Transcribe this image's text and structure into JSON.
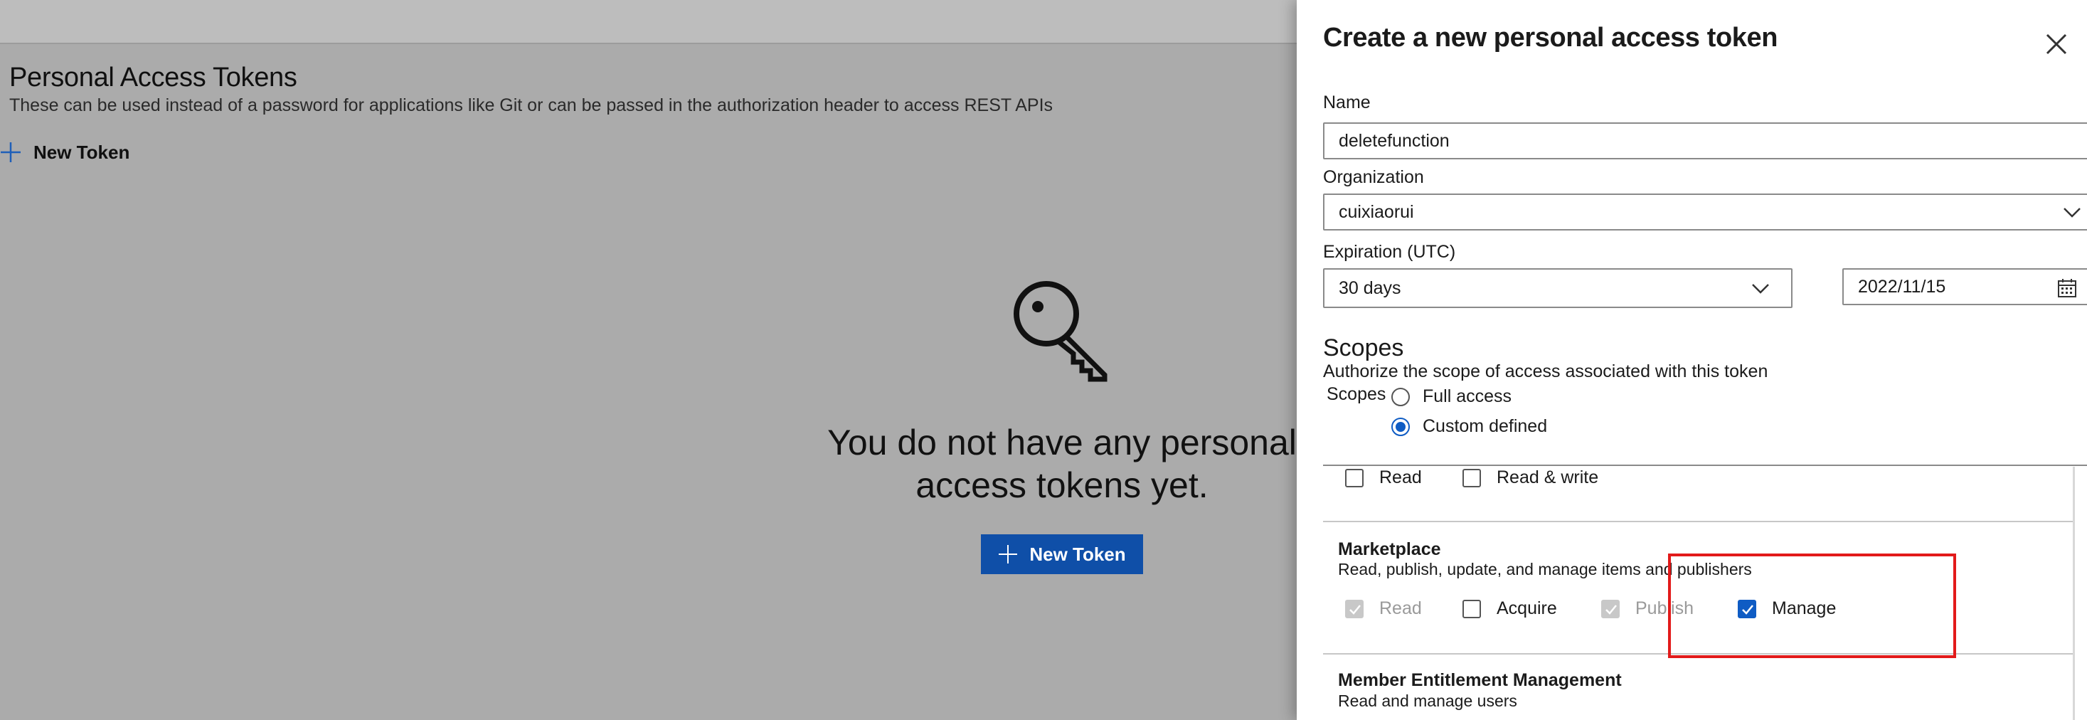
{
  "background": {
    "page_title": "Personal Access Tokens",
    "page_subtitle": "These can be used instead of a password for applications like Git or can be passed in the authorization header to access REST APIs",
    "new_token_link": "New Token",
    "empty_state_line1": "You do not have any personal",
    "empty_state_line2": "access tokens yet.",
    "new_token_button": "New Token",
    "key_icon": "key-icon"
  },
  "panel": {
    "title": "Create a new personal access token",
    "name_label": "Name",
    "name_value": "deletefunction",
    "organization_label": "Organization",
    "organization_value": "cuixiaorui",
    "expiration_label": "Expiration (UTC)",
    "expiration_value": "30 days",
    "expiration_date": "2022/11/15",
    "scopes_heading": "Scopes",
    "scopes_description": "Authorize the scope of access associated with this token",
    "scopes_inline_label": "Scopes",
    "radio_full_access": "Full access",
    "radio_custom_defined": "Custom defined",
    "scopes_selected": "Custom defined",
    "prev_section": {
      "read": "Read",
      "read_write": "Read & write"
    },
    "marketplace": {
      "title": "Marketplace",
      "description": "Read, publish, update, and manage items and publishers",
      "read": "Read",
      "acquire": "Acquire",
      "publish": "Publish",
      "manage": "Manage",
      "checked": [
        "Read",
        "Publish",
        "Manage"
      ],
      "disabled": [
        "Read",
        "Publish"
      ]
    },
    "member_entitlement": {
      "title": "Member Entitlement Management",
      "description": "Read and manage users"
    }
  },
  "colors": {
    "accent": "#0f5cc4",
    "primary_button": "#0f4fa8",
    "highlight_box": "#e21a1a",
    "overlay_background": "#ababab"
  }
}
